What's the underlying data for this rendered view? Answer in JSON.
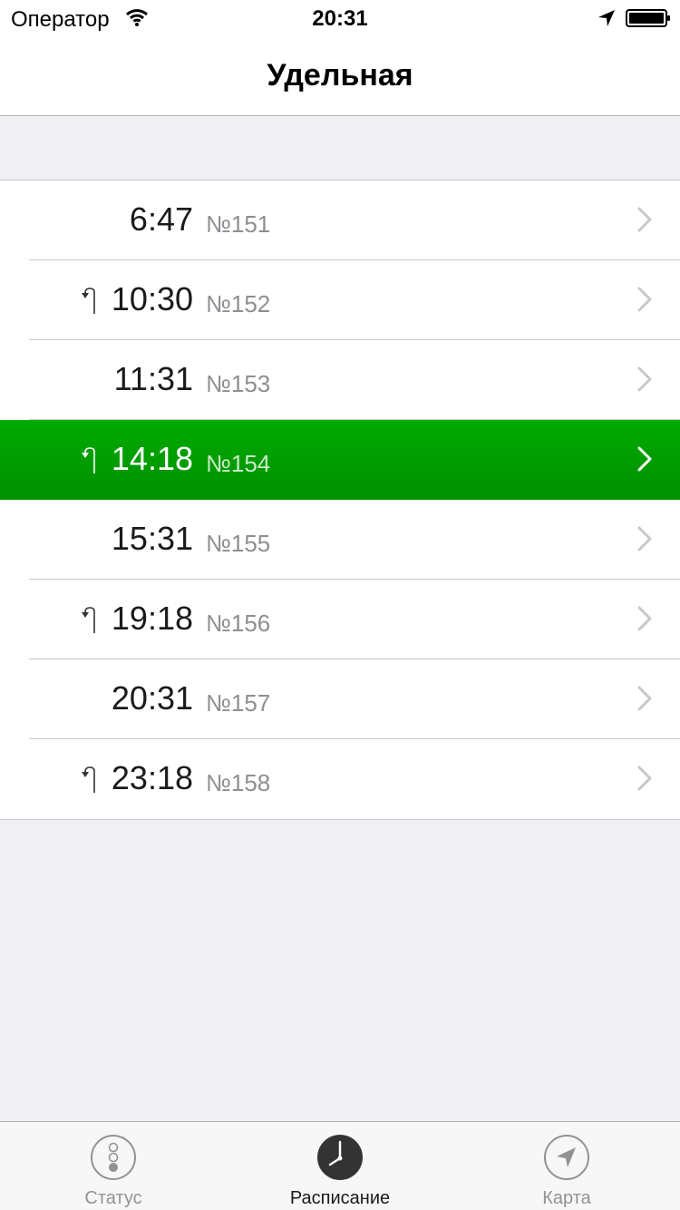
{
  "status_bar": {
    "carrier": "Оператор",
    "time": "20:31",
    "wifi_icon": "wifi-icon",
    "location_icon": "location-arrow-icon",
    "battery_icon": "battery-icon"
  },
  "nav": {
    "title": "Удельная"
  },
  "schedule": {
    "selected_color": "#00a000",
    "rows": [
      {
        "time": "6:47",
        "number": "№151",
        "return_icon": false,
        "selected": false
      },
      {
        "time": "10:30",
        "number": "№152",
        "return_icon": true,
        "selected": false
      },
      {
        "time": "11:31",
        "number": "№153",
        "return_icon": false,
        "selected": false
      },
      {
        "time": "14:18",
        "number": "№154",
        "return_icon": true,
        "selected": true
      },
      {
        "time": "15:31",
        "number": "№155",
        "return_icon": false,
        "selected": false
      },
      {
        "time": "19:18",
        "number": "№156",
        "return_icon": true,
        "selected": false
      },
      {
        "time": "20:31",
        "number": "№157",
        "return_icon": false,
        "selected": false
      },
      {
        "time": "23:18",
        "number": "№158",
        "return_icon": true,
        "selected": false
      }
    ]
  },
  "tabs": [
    {
      "label": "Статус",
      "icon": "traffic-light-icon",
      "active": false
    },
    {
      "label": "Расписание",
      "icon": "clock-icon",
      "active": true
    },
    {
      "label": "Карта",
      "icon": "compass-arrow-icon",
      "active": false
    }
  ]
}
